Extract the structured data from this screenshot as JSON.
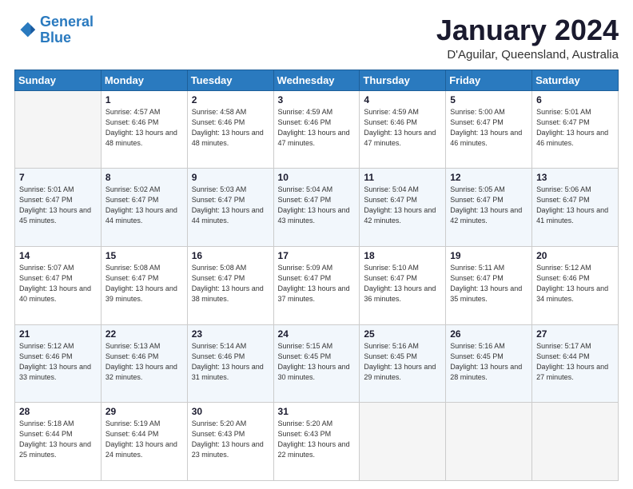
{
  "header": {
    "logo_line1": "General",
    "logo_line2": "Blue",
    "month_title": "January 2024",
    "location": "D'Aguilar, Queensland, Australia"
  },
  "weekdays": [
    "Sunday",
    "Monday",
    "Tuesday",
    "Wednesday",
    "Thursday",
    "Friday",
    "Saturday"
  ],
  "weeks": [
    [
      {
        "day": "",
        "empty": true
      },
      {
        "day": "1",
        "sunrise": "4:57 AM",
        "sunset": "6:46 PM",
        "daylight": "13 hours and 48 minutes."
      },
      {
        "day": "2",
        "sunrise": "4:58 AM",
        "sunset": "6:46 PM",
        "daylight": "13 hours and 48 minutes."
      },
      {
        "day": "3",
        "sunrise": "4:59 AM",
        "sunset": "6:46 PM",
        "daylight": "13 hours and 47 minutes."
      },
      {
        "day": "4",
        "sunrise": "4:59 AM",
        "sunset": "6:46 PM",
        "daylight": "13 hours and 47 minutes."
      },
      {
        "day": "5",
        "sunrise": "5:00 AM",
        "sunset": "6:47 PM",
        "daylight": "13 hours and 46 minutes."
      },
      {
        "day": "6",
        "sunrise": "5:01 AM",
        "sunset": "6:47 PM",
        "daylight": "13 hours and 46 minutes."
      }
    ],
    [
      {
        "day": "7",
        "sunrise": "5:01 AM",
        "sunset": "6:47 PM",
        "daylight": "13 hours and 45 minutes."
      },
      {
        "day": "8",
        "sunrise": "5:02 AM",
        "sunset": "6:47 PM",
        "daylight": "13 hours and 44 minutes."
      },
      {
        "day": "9",
        "sunrise": "5:03 AM",
        "sunset": "6:47 PM",
        "daylight": "13 hours and 44 minutes."
      },
      {
        "day": "10",
        "sunrise": "5:04 AM",
        "sunset": "6:47 PM",
        "daylight": "13 hours and 43 minutes."
      },
      {
        "day": "11",
        "sunrise": "5:04 AM",
        "sunset": "6:47 PM",
        "daylight": "13 hours and 42 minutes."
      },
      {
        "day": "12",
        "sunrise": "5:05 AM",
        "sunset": "6:47 PM",
        "daylight": "13 hours and 42 minutes."
      },
      {
        "day": "13",
        "sunrise": "5:06 AM",
        "sunset": "6:47 PM",
        "daylight": "13 hours and 41 minutes."
      }
    ],
    [
      {
        "day": "14",
        "sunrise": "5:07 AM",
        "sunset": "6:47 PM",
        "daylight": "13 hours and 40 minutes."
      },
      {
        "day": "15",
        "sunrise": "5:08 AM",
        "sunset": "6:47 PM",
        "daylight": "13 hours and 39 minutes."
      },
      {
        "day": "16",
        "sunrise": "5:08 AM",
        "sunset": "6:47 PM",
        "daylight": "13 hours and 38 minutes."
      },
      {
        "day": "17",
        "sunrise": "5:09 AM",
        "sunset": "6:47 PM",
        "daylight": "13 hours and 37 minutes."
      },
      {
        "day": "18",
        "sunrise": "5:10 AM",
        "sunset": "6:47 PM",
        "daylight": "13 hours and 36 minutes."
      },
      {
        "day": "19",
        "sunrise": "5:11 AM",
        "sunset": "6:47 PM",
        "daylight": "13 hours and 35 minutes."
      },
      {
        "day": "20",
        "sunrise": "5:12 AM",
        "sunset": "6:46 PM",
        "daylight": "13 hours and 34 minutes."
      }
    ],
    [
      {
        "day": "21",
        "sunrise": "5:12 AM",
        "sunset": "6:46 PM",
        "daylight": "13 hours and 33 minutes."
      },
      {
        "day": "22",
        "sunrise": "5:13 AM",
        "sunset": "6:46 PM",
        "daylight": "13 hours and 32 minutes."
      },
      {
        "day": "23",
        "sunrise": "5:14 AM",
        "sunset": "6:46 PM",
        "daylight": "13 hours and 31 minutes."
      },
      {
        "day": "24",
        "sunrise": "5:15 AM",
        "sunset": "6:45 PM",
        "daylight": "13 hours and 30 minutes."
      },
      {
        "day": "25",
        "sunrise": "5:16 AM",
        "sunset": "6:45 PM",
        "daylight": "13 hours and 29 minutes."
      },
      {
        "day": "26",
        "sunrise": "5:16 AM",
        "sunset": "6:45 PM",
        "daylight": "13 hours and 28 minutes."
      },
      {
        "day": "27",
        "sunrise": "5:17 AM",
        "sunset": "6:44 PM",
        "daylight": "13 hours and 27 minutes."
      }
    ],
    [
      {
        "day": "28",
        "sunrise": "5:18 AM",
        "sunset": "6:44 PM",
        "daylight": "13 hours and 25 minutes."
      },
      {
        "day": "29",
        "sunrise": "5:19 AM",
        "sunset": "6:44 PM",
        "daylight": "13 hours and 24 minutes."
      },
      {
        "day": "30",
        "sunrise": "5:20 AM",
        "sunset": "6:43 PM",
        "daylight": "13 hours and 23 minutes."
      },
      {
        "day": "31",
        "sunrise": "5:20 AM",
        "sunset": "6:43 PM",
        "daylight": "13 hours and 22 minutes."
      },
      {
        "day": "",
        "empty": true
      },
      {
        "day": "",
        "empty": true
      },
      {
        "day": "",
        "empty": true
      }
    ]
  ]
}
